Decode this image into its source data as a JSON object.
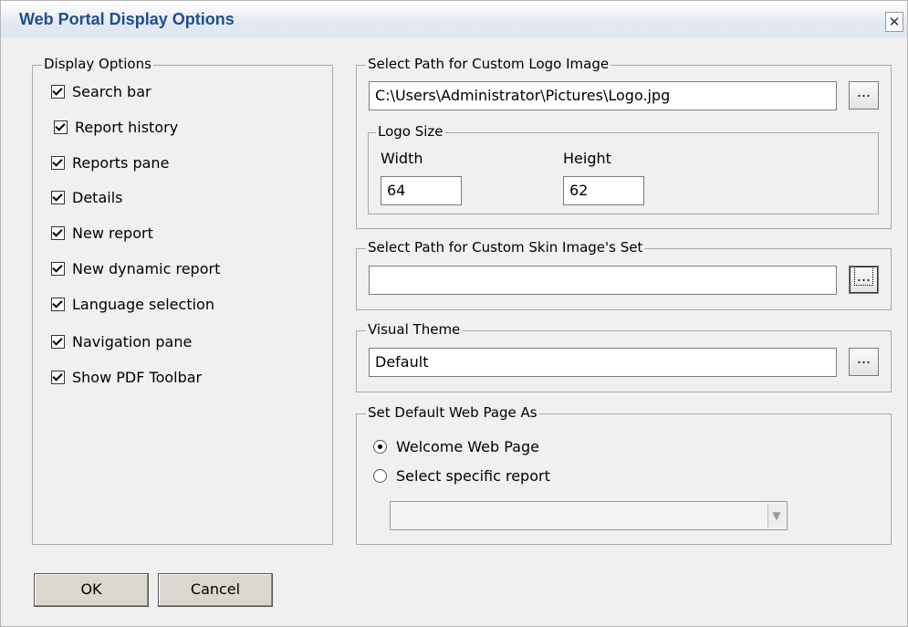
{
  "window": {
    "title": "Web Portal Display Options",
    "close_glyph": "✕"
  },
  "display_options": {
    "legend": "Display Options",
    "items": [
      {
        "label": "Search bar",
        "checked": true
      },
      {
        "label": "Report history",
        "checked": true
      },
      {
        "label": "Reports pane",
        "checked": true
      },
      {
        "label": "Details",
        "checked": true
      },
      {
        "label": "New report",
        "checked": true
      },
      {
        "label": "New dynamic report",
        "checked": true
      },
      {
        "label": "Language selection",
        "checked": true
      },
      {
        "label": "Navigation pane",
        "checked": true
      },
      {
        "label": "Show PDF Toolbar",
        "checked": true
      }
    ]
  },
  "logo": {
    "legend": "Select Path for Custom Logo Image",
    "path": "C:\\Users\\Administrator\\Pictures\\Logo.jpg",
    "browse_label": "...",
    "size": {
      "legend": "Logo Size",
      "width_label": "Width",
      "width_value": "64",
      "height_label": "Height",
      "height_value": "62"
    }
  },
  "skin": {
    "legend": "Select Path for Custom Skin Image's Set",
    "path": "",
    "browse_label": "..."
  },
  "theme": {
    "legend": "Visual Theme",
    "value": "Default",
    "browse_label": "..."
  },
  "default_page": {
    "legend": "Set Default Web Page As",
    "options": [
      {
        "label": "Welcome Web Page",
        "selected": true
      },
      {
        "label": "Select specific report",
        "selected": false
      }
    ],
    "report_select_value": ""
  },
  "buttons": {
    "ok": "OK",
    "cancel": "Cancel"
  }
}
